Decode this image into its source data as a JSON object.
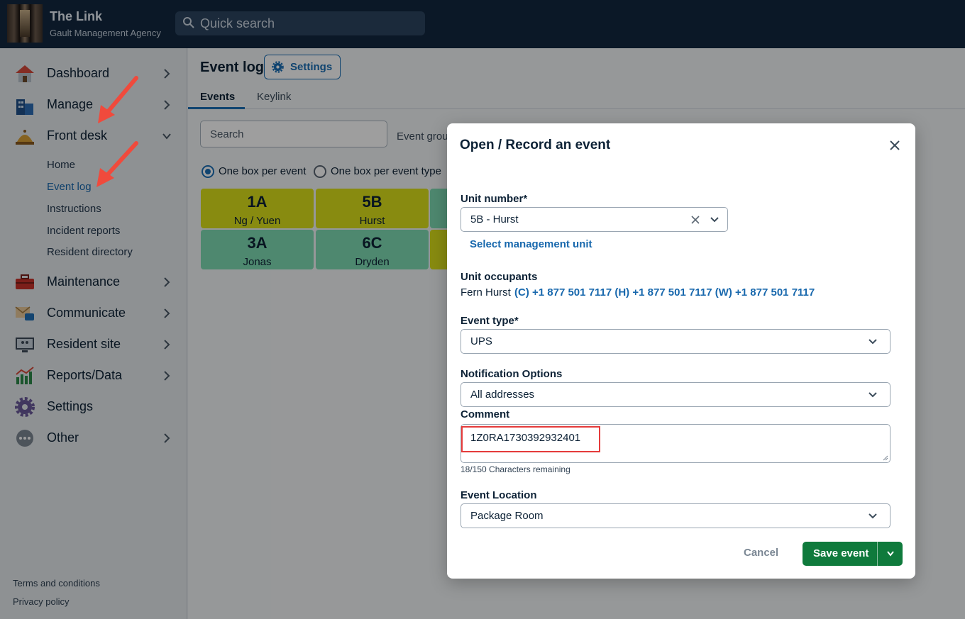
{
  "app": {
    "title": "The Link",
    "subtitle": "Gault Management Agency",
    "search_placeholder": "Quick search"
  },
  "sidebar": {
    "items": [
      {
        "label": "Dashboard",
        "icon": "house-icon"
      },
      {
        "label": "Manage",
        "icon": "building-icon"
      },
      {
        "label": "Front desk",
        "icon": "service-bell-icon"
      },
      {
        "label": "Maintenance",
        "icon": "toolbox-icon"
      },
      {
        "label": "Communicate",
        "icon": "mail-chat-icon"
      },
      {
        "label": "Resident site",
        "icon": "monitor-people-icon"
      },
      {
        "label": "Reports/Data",
        "icon": "bar-chart-icon"
      },
      {
        "label": "Settings",
        "icon": "gear-icon"
      },
      {
        "label": "Other",
        "icon": "more-dots-icon"
      }
    ],
    "front_desk_sub": [
      "Home",
      "Event log",
      "Instructions",
      "Incident reports",
      "Resident directory"
    ],
    "footer": [
      "Terms and conditions",
      "Privacy policy"
    ]
  },
  "main": {
    "page_title": "Event log",
    "settings_label": "Settings",
    "tabs": [
      "Events",
      "Keylink"
    ],
    "search_placeholder": "Search",
    "event_group_label": "Event grou",
    "radio_options": [
      "One box per event",
      "One box per event type"
    ],
    "units": [
      {
        "unit": "1A",
        "name": "Ng / Yuen",
        "color": "#dbe01a"
      },
      {
        "unit": "5B",
        "name": "Hurst",
        "color": "#dbe01a"
      },
      {
        "unit": "3A",
        "name": "Jonas",
        "color": "#7fdcb4"
      },
      {
        "unit": "6C",
        "name": "Dryden",
        "color": "#7fdcb4"
      }
    ]
  },
  "modal": {
    "title": "Open / Record an event",
    "unit_number_label": "Unit number*",
    "unit_number_value": "5B - Hurst",
    "select_management_unit": "Select management unit",
    "occupants_label": "Unit occupants",
    "occupant_name": "Fern Hurst",
    "occupant_phones": "(C) +1 877 501 7117 (H) +1 877 501 7117 (W) +1 877 501 7117",
    "event_type_label": "Event type*",
    "event_type_value": "UPS",
    "notification_label": "Notification Options",
    "notification_value": "All addresses",
    "comment_label": "Comment",
    "comment_value": "1Z0RA1730392932401",
    "chars_remaining": "18/150 Characters remaining",
    "location_label": "Event Location",
    "location_value": "Package Room",
    "cancel_label": "Cancel",
    "save_label": "Save event"
  },
  "colors": {
    "header": "#13283f",
    "accent": "#1a6fb5",
    "save": "#0f7a3c",
    "highlight": "#e53b3b",
    "annotation_arrow": "#f04a3c"
  }
}
